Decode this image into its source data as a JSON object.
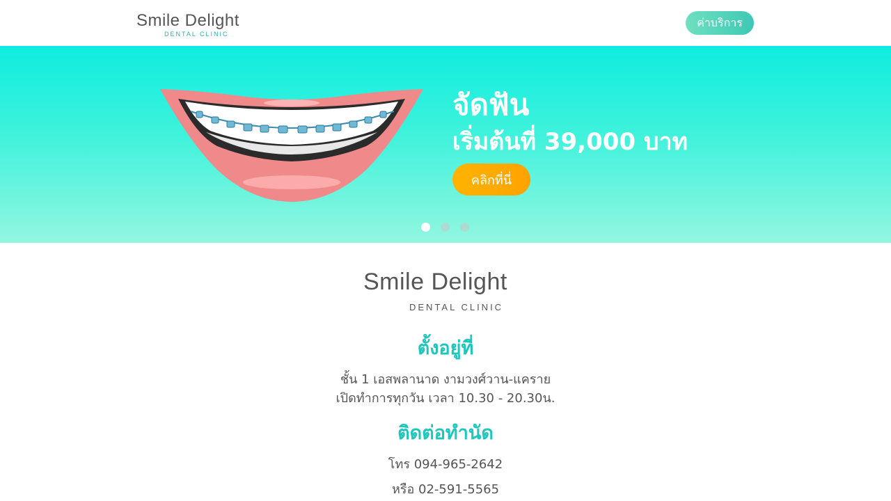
{
  "header": {
    "logo_text": "Smile Delight",
    "logo_subtext": "DENTAL CLINIC",
    "price_button": "ค่าบริการ"
  },
  "banner": {
    "title": "จัดฟัน",
    "subtitle": "เริ่มต้นที่ 39,000 บาท",
    "cta": "คลิกที่นี่",
    "slide_count": 3,
    "active_slide": 1
  },
  "clinic": {
    "logo_text": "Smile Delight",
    "logo_subtext": "DENTAL CLINIC"
  },
  "location": {
    "heading": "ตั้งอยู่ที่",
    "address": "ชั้น 1 เอสพลานาด งามวงศ์วาน-แคราย",
    "hours": "เปิดทำการทุกวัน เวลา 10.30 - 20.30น."
  },
  "contact": {
    "heading": "ติดต่อทำนัด",
    "phone1": "โทร 094-965-2642",
    "phone2": "หรือ 02-591-5565"
  },
  "colors": {
    "accent": "#1fc6bb",
    "banner_top": "#0eeddf",
    "cta": "#ffb300"
  }
}
